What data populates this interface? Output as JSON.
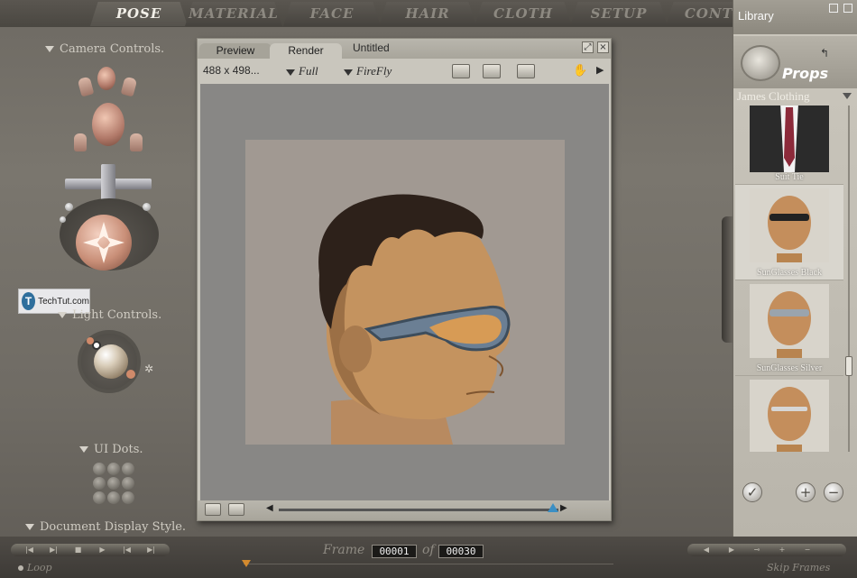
{
  "tabs": [
    "POSE",
    "MATERIAL",
    "FACE",
    "HAIR",
    "CLOTH",
    "SETUP",
    "CONTE"
  ],
  "left_panel": {
    "camera_controls": "Camera Controls.",
    "light_controls": "Light Controls.",
    "ui_dots": "UI Dots.",
    "document_display_style": "Document Display Style."
  },
  "watermark": {
    "logo": "T",
    "text": "TechTut.com"
  },
  "render_window": {
    "tabs": [
      "Preview",
      "Render"
    ],
    "title": "Untitled",
    "size": "488 x 498...",
    "resolution": "Full",
    "renderer": "FireFly"
  },
  "library": {
    "title": "Library",
    "category": "Props",
    "subcategory": "James Clothing",
    "items": [
      {
        "name": "Suit Tie",
        "selected": false
      },
      {
        "name": "SunGlasses Black",
        "selected": true
      },
      {
        "name": "SunGlasses Silver",
        "selected": false
      },
      {
        "name": "",
        "selected": false
      }
    ]
  },
  "animation": {
    "loop_label": "Loop",
    "frame_label": "Frame",
    "of_label": "of",
    "current_frame": "00001",
    "total_frames": "00030",
    "skip_frames_label": "Skip Frames"
  },
  "colors": {
    "accent": "#3b8fc4",
    "marker": "#d48a2e"
  }
}
